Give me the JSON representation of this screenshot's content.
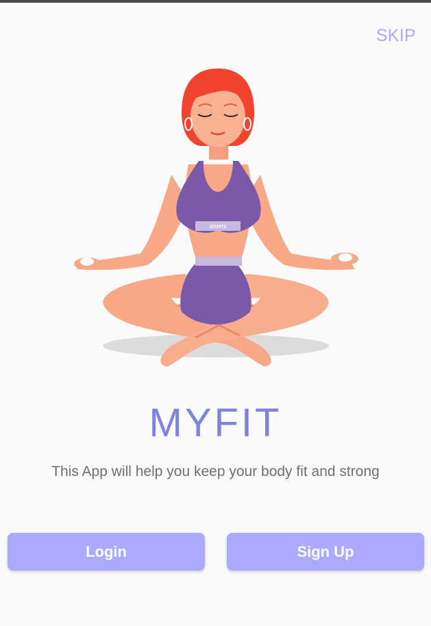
{
  "header": {
    "skip_label": "SKIP"
  },
  "hero": {
    "illustration": "meditating-woman-illustration",
    "top_badge_text": "SPORTS"
  },
  "content": {
    "title": "MYFIT",
    "subtitle": "This App will help you keep your body fit and strong"
  },
  "actions": {
    "login_label": "Login",
    "signup_label": "Sign Up"
  },
  "colors": {
    "accent": "#aaaaff",
    "title": "#7f83dd",
    "text": "#6f6f6f",
    "background": "#fafafa"
  }
}
